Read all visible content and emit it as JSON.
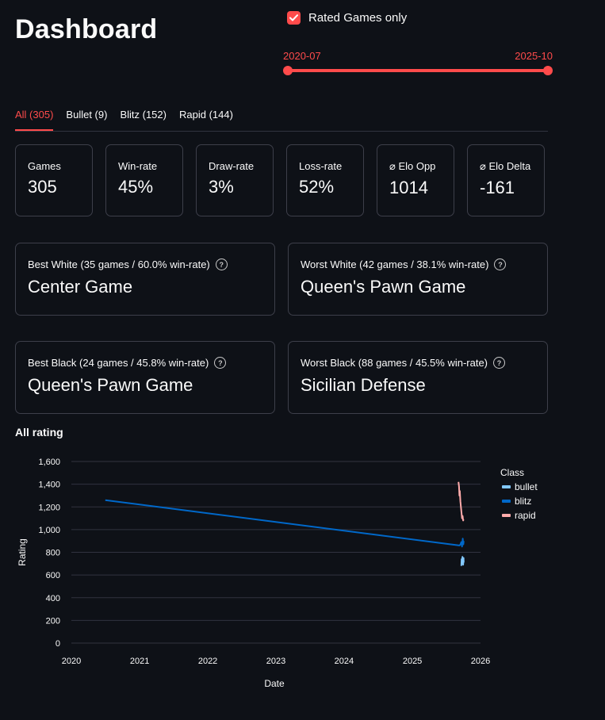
{
  "header": {
    "title": "Dashboard"
  },
  "filters": {
    "rated_only_label": "Rated Games only",
    "rated_only_checked": true,
    "date_range": {
      "start": "2020-07",
      "end": "2025-10"
    }
  },
  "tabs": [
    {
      "label": "All (305)",
      "active": true
    },
    {
      "label": "Bullet (9)",
      "active": false
    },
    {
      "label": "Blitz (152)",
      "active": false
    },
    {
      "label": "Rapid (144)",
      "active": false
    }
  ],
  "metrics": [
    {
      "label": "Games",
      "value": "305"
    },
    {
      "label": "Win-rate",
      "value": "45%"
    },
    {
      "label": "Draw-rate",
      "value": "3%"
    },
    {
      "label": "Loss-rate",
      "value": "52%"
    },
    {
      "label": "⌀ Elo Opp",
      "value": "1014"
    },
    {
      "label": "⌀ Elo Delta",
      "value": "-161"
    }
  ],
  "openings": {
    "best_white": {
      "label": "Best White (35 games / 60.0% win-rate)",
      "value": "Center Game"
    },
    "worst_white": {
      "label": "Worst White (42 games / 38.1% win-rate)",
      "value": "Queen's Pawn Game"
    },
    "best_black": {
      "label": "Best Black (24 games / 45.8% win-rate)",
      "value": "Queen's Pawn Game"
    },
    "worst_black": {
      "label": "Worst Black (88 games / 45.5% win-rate)",
      "value": "Sicilian Defense"
    }
  },
  "chart_section": {
    "title": "All rating"
  },
  "chart_data": {
    "type": "line",
    "xlabel": "Date",
    "ylabel": "Rating",
    "x_ticks": [
      "2020",
      "2021",
      "2022",
      "2023",
      "2024",
      "2025",
      "2026"
    ],
    "y_ticks": [
      "0",
      "200",
      "400",
      "600",
      "800",
      "1,000",
      "1,200",
      "1,400",
      "1,600"
    ],
    "ylim": [
      0,
      1600
    ],
    "xlim": [
      "2020-01",
      "2026-01"
    ],
    "grid": true,
    "legend_title": "Class",
    "legend_position": "right",
    "series": [
      {
        "name": "bullet",
        "color": "#83c9ff",
        "points": [
          [
            "2025-09-20",
            680
          ],
          [
            "2025-09-22",
            740
          ],
          [
            "2025-09-24",
            700
          ],
          [
            "2025-09-26",
            760
          ],
          [
            "2025-09-28",
            720
          ],
          [
            "2025-09-30",
            690
          ],
          [
            "2025-10-02",
            750
          ],
          [
            "2025-10-03",
            710
          ]
        ]
      },
      {
        "name": "blitz",
        "color": "#0068c9",
        "points": [
          [
            "2020-07-01",
            1260
          ],
          [
            "2025-09-10",
            860
          ],
          [
            "2025-09-16",
            870
          ],
          [
            "2025-09-20",
            890
          ],
          [
            "2025-09-24",
            850
          ],
          [
            "2025-09-28",
            920
          ],
          [
            "2025-10-01",
            870
          ],
          [
            "2025-10-03",
            900
          ]
        ]
      },
      {
        "name": "rapid",
        "color": "#ffabab",
        "points": [
          [
            "2025-09-05",
            1420
          ],
          [
            "2025-09-08",
            1380
          ],
          [
            "2025-09-10",
            1300
          ],
          [
            "2025-09-12",
            1340
          ],
          [
            "2025-09-15",
            1250
          ],
          [
            "2025-09-18",
            1200
          ],
          [
            "2025-09-21",
            1150
          ],
          [
            "2025-09-24",
            1100
          ],
          [
            "2025-09-27",
            1120
          ],
          [
            "2025-09-30",
            1080
          ],
          [
            "2025-10-02",
            1090
          ]
        ]
      }
    ]
  }
}
